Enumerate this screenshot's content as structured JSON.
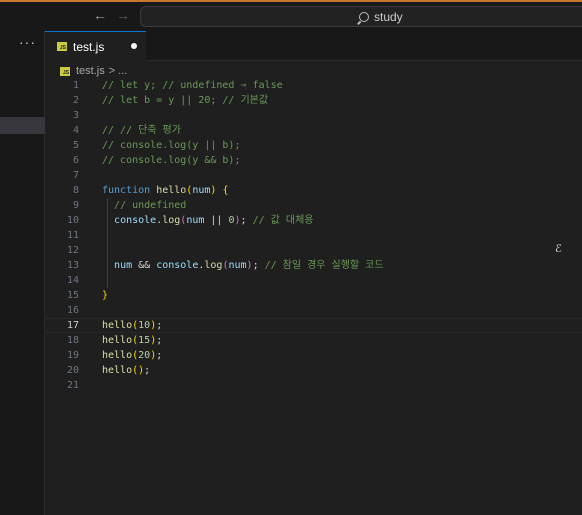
{
  "titlebar": {
    "back_icon": "arrow-left-icon",
    "forward_icon": "arrow-right-icon",
    "search_text": "study"
  },
  "sidebar": {
    "more_label": "···"
  },
  "tab": {
    "label": "test.js",
    "icon_text": "JS"
  },
  "breadcrumb": {
    "file": "test.js",
    "sep": ">",
    "symbol": "..."
  },
  "editor": {
    "lines": [
      [
        [
          "c",
          "// let y; // undefined ⇒ false"
        ]
      ],
      [
        [
          "c",
          "// let b = y || 20; // 기본값"
        ]
      ],
      [],
      [
        [
          "c",
          "// // 단축 평가"
        ]
      ],
      [
        [
          "c",
          "// console.log(y || b);"
        ]
      ],
      [
        [
          "c",
          "// console.log(y && b);"
        ]
      ],
      [],
      [
        [
          "k",
          "function "
        ],
        [
          "f",
          "hello"
        ],
        [
          "b1",
          "("
        ],
        [
          "v",
          "num"
        ],
        [
          "b1",
          ")"
        ],
        [
          "p",
          " "
        ],
        [
          "b1",
          "{"
        ]
      ],
      [
        [
          "p",
          "  "
        ],
        [
          "c",
          "// undefined"
        ]
      ],
      [
        [
          "p",
          "  "
        ],
        [
          "v",
          "console"
        ],
        [
          "p",
          "."
        ],
        [
          "f",
          "log"
        ],
        [
          "b2",
          "("
        ],
        [
          "v",
          "num"
        ],
        [
          "p",
          " || "
        ],
        [
          "n",
          "0"
        ],
        [
          "b2",
          ")"
        ],
        [
          "p",
          "; "
        ],
        [
          "c",
          "// 값 대체용"
        ]
      ],
      [],
      [],
      [
        [
          "p",
          "  "
        ],
        [
          "v",
          "num"
        ],
        [
          "p",
          " && "
        ],
        [
          "v",
          "console"
        ],
        [
          "p",
          "."
        ],
        [
          "f",
          "log"
        ],
        [
          "b2",
          "("
        ],
        [
          "v",
          "num"
        ],
        [
          "b2",
          ")"
        ],
        [
          "p",
          "; "
        ],
        [
          "c",
          "// 참일 경우 실행할 코드"
        ]
      ],
      [],
      [
        [
          "b1",
          "}"
        ]
      ],
      [],
      [
        [
          "f",
          "hello"
        ],
        [
          "b1",
          "("
        ],
        [
          "n",
          "10"
        ],
        [
          "b1",
          ")"
        ],
        [
          "p",
          ";"
        ]
      ],
      [
        [
          "f",
          "hello"
        ],
        [
          "b1",
          "("
        ],
        [
          "n",
          "15"
        ],
        [
          "b1",
          ")"
        ],
        [
          "p",
          ";"
        ]
      ],
      [
        [
          "f",
          "hello"
        ],
        [
          "b1",
          "("
        ],
        [
          "n",
          "20"
        ],
        [
          "b1",
          ")"
        ],
        [
          "p",
          ";"
        ]
      ],
      [
        [
          "f",
          "hello"
        ],
        [
          "b1",
          "()"
        ],
        [
          "p",
          ";"
        ]
      ],
      []
    ],
    "line_numbers": [
      "1",
      "2",
      "3",
      "4",
      "5",
      "6",
      "7",
      "8",
      "9",
      "10",
      "11",
      "12",
      "13",
      "14",
      "15",
      "16",
      "17",
      "18",
      "19",
      "20",
      "21"
    ],
    "current_line": 17
  },
  "colors": {
    "comment": "#6a9955",
    "keyword": "#569cd6",
    "function": "#dcdcaa",
    "variable": "#9cdcfe",
    "number": "#b5cea8",
    "accent": "#0078d4"
  }
}
